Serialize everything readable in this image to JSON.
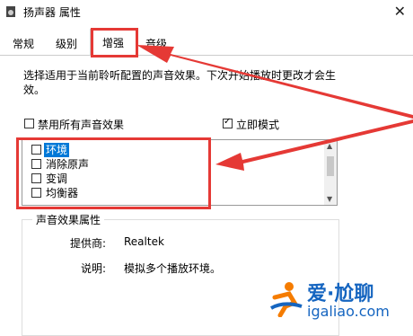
{
  "window": {
    "title": "扬声器 属性",
    "close_glyph": "✕"
  },
  "tabs": [
    {
      "label": "常规",
      "active": false
    },
    {
      "label": "级别",
      "active": false
    },
    {
      "label": "增强",
      "active": true
    },
    {
      "label": "音级",
      "active": false
    }
  ],
  "panel": {
    "description": "选择适用于当前聆听配置的声音效果。下次开始播放时更改才会生效。",
    "disable_all": {
      "label": "禁用所有声音效果",
      "checked": false
    },
    "immediate_mode": {
      "label": "立即模式",
      "checked": true
    },
    "effects": [
      {
        "label": "环境",
        "checked": false,
        "selected": true
      },
      {
        "label": "消除原声",
        "checked": false,
        "selected": false
      },
      {
        "label": "变调",
        "checked": false,
        "selected": false
      },
      {
        "label": "均衡器",
        "checked": false,
        "selected": false
      }
    ],
    "properties_group": {
      "title": "声音效果属性",
      "provider_label": "提供商:",
      "provider_value": "Realtek",
      "desc_label": "说明:",
      "desc_value": "模拟多个播放环境。"
    }
  },
  "watermark": {
    "brand": "爱·尬聊",
    "domain": "igaliao.com"
  },
  "colors": {
    "annotation_red": "#e53935",
    "selection_blue": "#0078d7",
    "brand_blue": "#1565c0"
  }
}
